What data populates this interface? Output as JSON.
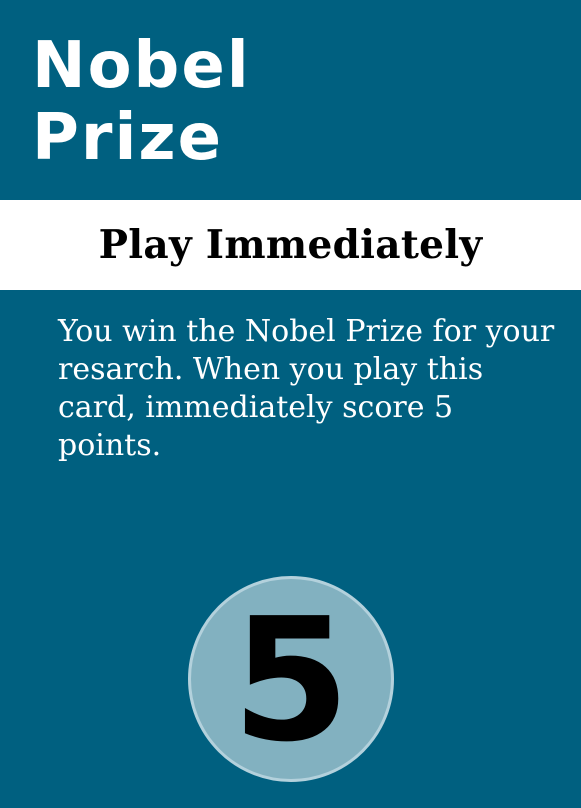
{
  "card": {
    "title_line1": "Nobel",
    "title_line2": "Prize",
    "banner": "Play Immediately",
    "description": "You win the Nobel Prize for your resarch. When you play this card, immediately score 5 points.",
    "points": "5"
  },
  "colors": {
    "background": "#006080",
    "banner": "#ffffff",
    "badge": "#82b1c0",
    "badge_border": "#b3d1dc"
  }
}
